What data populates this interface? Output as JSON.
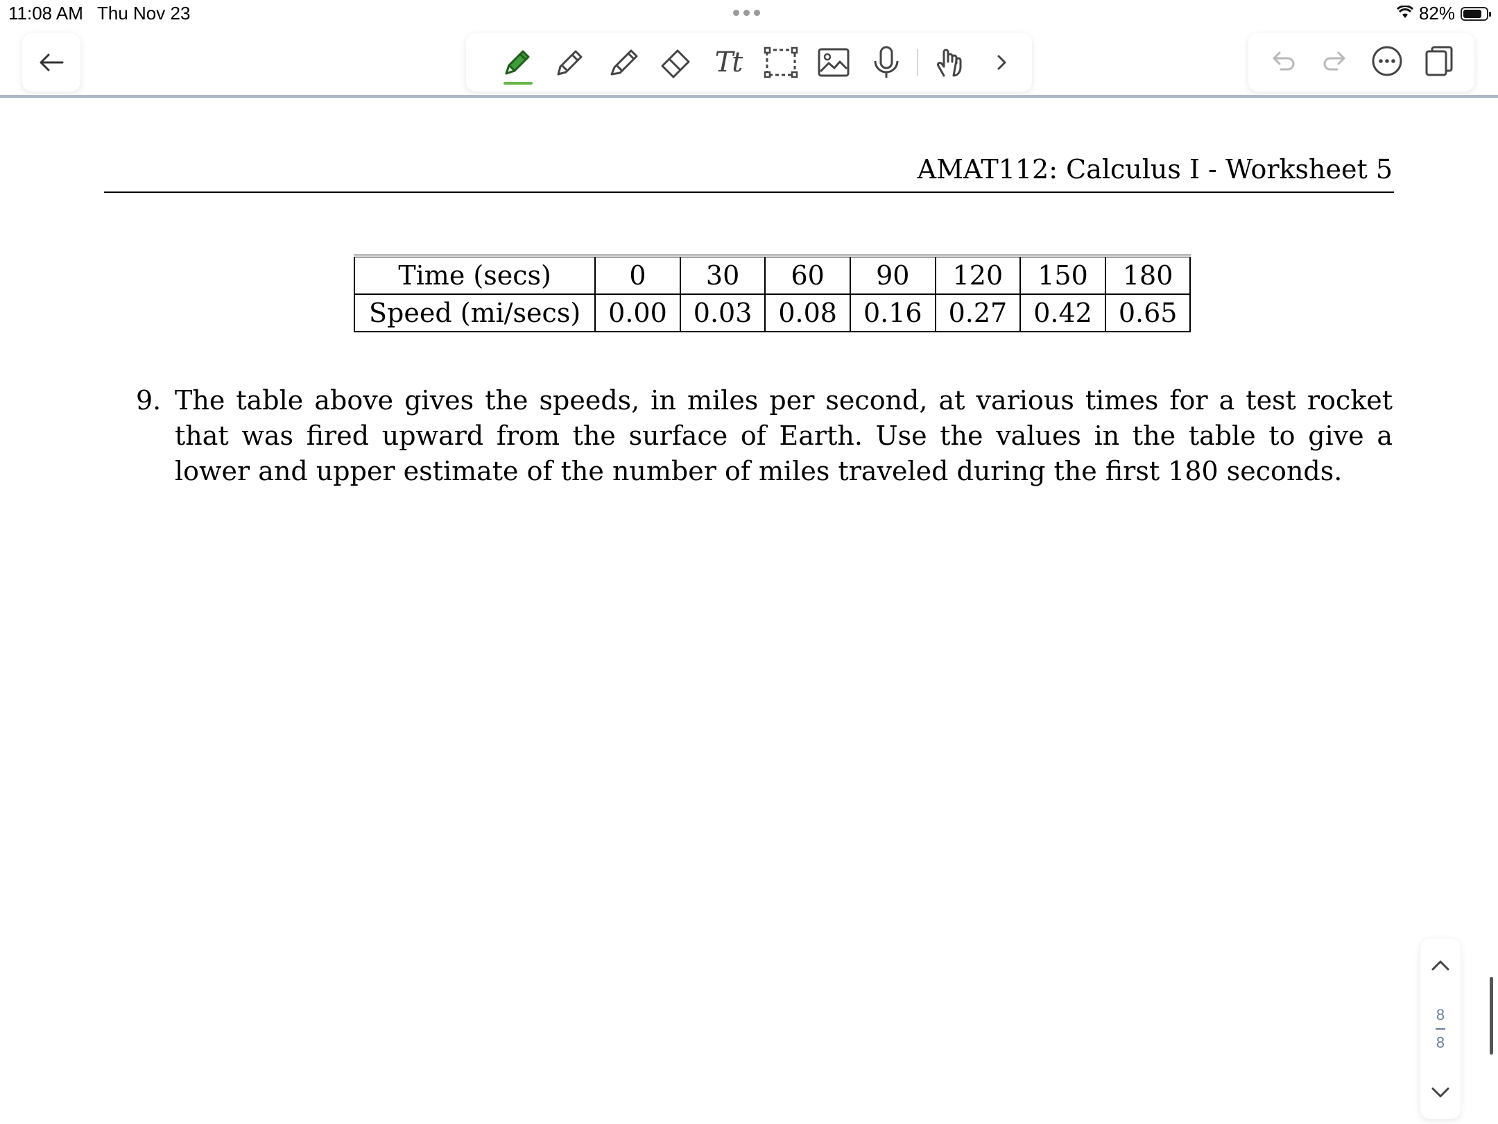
{
  "status": {
    "time": "11:08 AM",
    "date": "Thu Nov 23",
    "battery": "82%",
    "battery_level": 0.82
  },
  "toolbar": {
    "tools": [
      {
        "name": "pen-icon",
        "active": true,
        "color": "#3f9e3a"
      },
      {
        "name": "pencil-icon"
      },
      {
        "name": "highlighter-icon"
      },
      {
        "name": "eraser-icon"
      },
      {
        "name": "text-tool-icon",
        "glyph": "Tt"
      },
      {
        "name": "lasso-select-icon"
      },
      {
        "name": "image-icon"
      },
      {
        "name": "microphone-icon"
      },
      {
        "name": "hand-pointer-icon"
      },
      {
        "name": "chevron-right-icon"
      }
    ]
  },
  "document": {
    "header": "AMAT112: Calculus I - Worksheet 5",
    "table": {
      "rows": [
        {
          "label": "Time (secs)",
          "values": [
            "0",
            "30",
            "60",
            "90",
            "120",
            "150",
            "180"
          ]
        },
        {
          "label": "Speed (mi/secs)",
          "values": [
            "0.00",
            "0.03",
            "0.08",
            "0.16",
            "0.27",
            "0.42",
            "0.65"
          ]
        }
      ]
    },
    "problem": {
      "number": "9.",
      "text": "The table above gives the speeds, in miles per second, at various times for a test rocket that was fired upward from the surface of Earth. Use the values in the table to give a lower and upper estimate of the number of miles traveled during the first 180 seconds."
    }
  },
  "page_nav": {
    "current": "8",
    "total": "8"
  },
  "colors": {
    "accent_green": "#66b84a",
    "divider": "#aab8c8",
    "icon_gray": "#444444"
  }
}
